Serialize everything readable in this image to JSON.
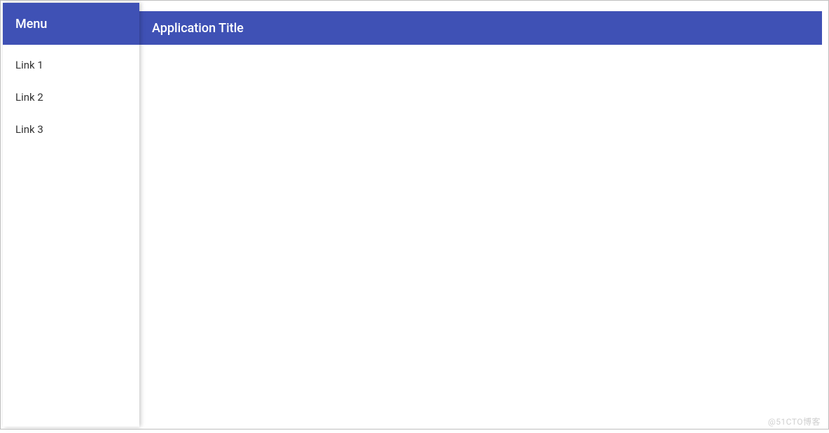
{
  "header": {
    "title": "Application Title"
  },
  "drawer": {
    "title": "Menu",
    "links": [
      {
        "label": "Link 1"
      },
      {
        "label": "Link 2"
      },
      {
        "label": "Link 3"
      }
    ]
  },
  "watermark": "@51CTO博客"
}
